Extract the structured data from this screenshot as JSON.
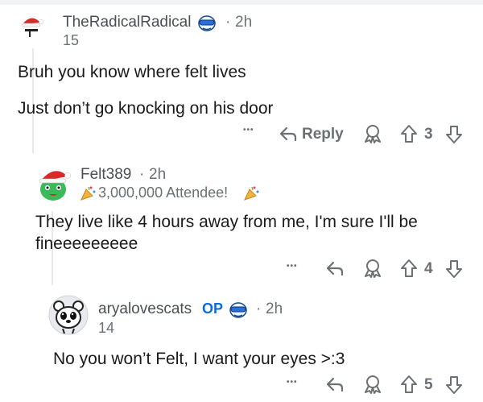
{
  "comments": [
    {
      "username": "TheRadicalRadical",
      "time": "2h",
      "flair": "15",
      "paragraphs": [
        "Bruh you know where felt lives",
        "Just don’t go knocking on his door"
      ],
      "reply_label": "Reply",
      "votes": "3"
    },
    {
      "username": "Felt389",
      "time": "2h",
      "flair": "3,000,000 Attendee!",
      "text": "They live like 4 hours away from me, I'm sure I'll be fineeeeeeeee",
      "votes": "4"
    },
    {
      "username": "aryalovescats",
      "op": "OP",
      "time": "2h",
      "flair": "14",
      "text": "No you won’t Felt, I want your eyes >:3",
      "votes": "5"
    }
  ],
  "separator": "·",
  "more": "•••",
  "colors": {
    "text": "#1a1a1b",
    "muted": "#6b7075",
    "op": "#0a6dd8",
    "avatar_bg": "#e8eaed"
  }
}
